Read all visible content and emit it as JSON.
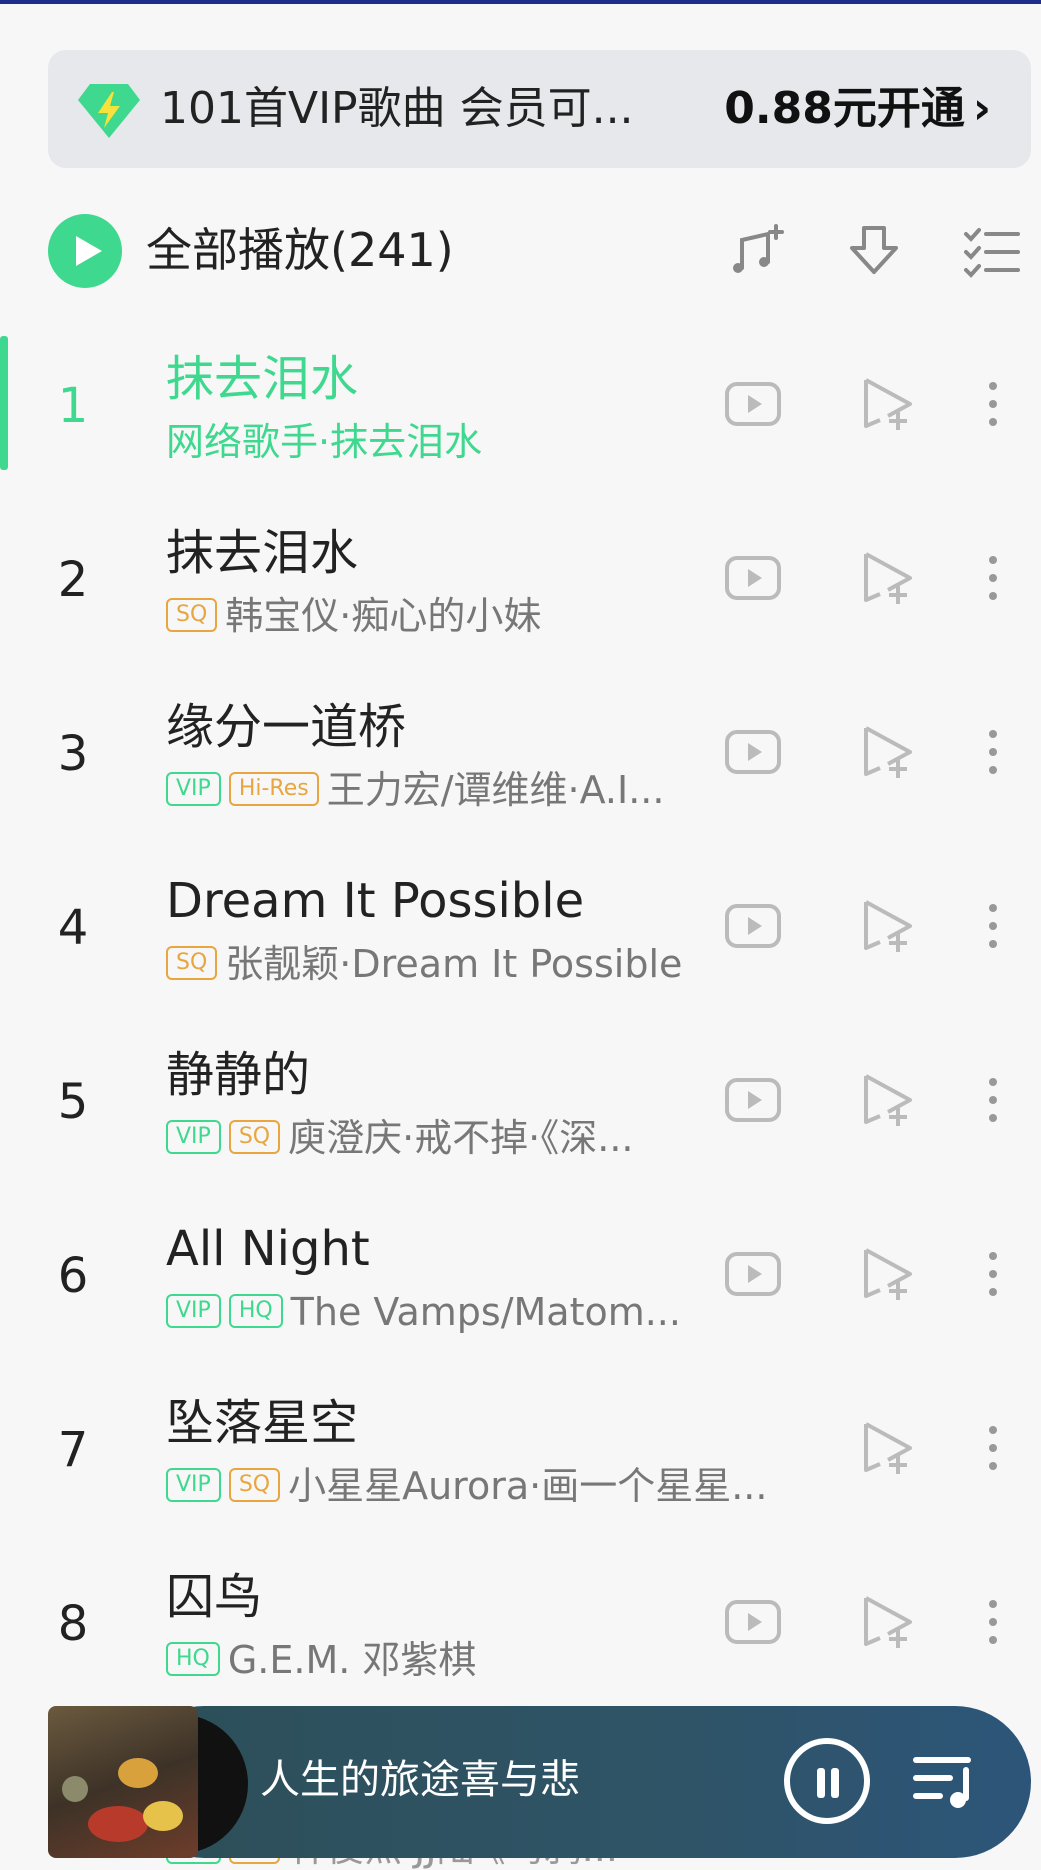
{
  "vip_banner": {
    "text": "101首VIP歌曲 会员可...",
    "cta": "0.88元开通",
    "cta_chevron": "›",
    "icon": "diamond-icon",
    "accent": "#3fd88f"
  },
  "play_all": {
    "label": "全部播放(241)",
    "icons": [
      "add-to-playlist-icon",
      "download-icon",
      "multi-select-icon"
    ]
  },
  "songs": [
    {
      "index": "1",
      "title": "抹去泪水",
      "badges": [],
      "subtitle": "网络歌手·抹去泪水",
      "active": true,
      "has_video": true
    },
    {
      "index": "2",
      "title": "抹去泪水",
      "badges": [
        "SQ"
      ],
      "subtitle": "韩宝仪·痴心的小妹",
      "active": false,
      "has_video": true
    },
    {
      "index": "3",
      "title": "缘分一道桥",
      "badges": [
        "VIP",
        "Hi-Res"
      ],
      "subtitle": "王力宏/谭维维·A.I...",
      "active": false,
      "has_video": true
    },
    {
      "index": "4",
      "title": "Dream It Possible",
      "badges": [
        "SQ"
      ],
      "subtitle": "张靓颖·Dream It Possible",
      "active": false,
      "has_video": true
    },
    {
      "index": "5",
      "title": "静静的",
      "badges": [
        "VIP",
        "SQ"
      ],
      "subtitle": "庾澄庆·戒不掉·《深...",
      "active": false,
      "has_video": true
    },
    {
      "index": "6",
      "title": "All Night",
      "badges": [
        "VIP",
        "HQ"
      ],
      "subtitle": "The Vamps/Matom...",
      "active": false,
      "has_video": true
    },
    {
      "index": "7",
      "title": "坠落星空",
      "badges": [
        "VIP",
        "SQ"
      ],
      "subtitle": "小星星Aurora·画一个星星...",
      "active": false,
      "has_video": false
    },
    {
      "index": "8",
      "title": "囚鸟",
      "badges": [
        "HQ"
      ],
      "subtitle": "G.E.M. 邓紫棋",
      "active": false,
      "has_video": true
    }
  ],
  "peek_row": {
    "badges": [
      "VIP",
      "SQ"
    ],
    "subtitle": "林俊杰·JJ陆·《鸟鸦..."
  },
  "mini_player": {
    "title": "人生的旅途喜与悲",
    "state": "playing",
    "icons": [
      "pause-icon",
      "playlist-queue-icon"
    ]
  },
  "colors": {
    "accent": "#3fd88f",
    "badge_orange": "#e8a540",
    "player_bg": "#2e5265"
  }
}
